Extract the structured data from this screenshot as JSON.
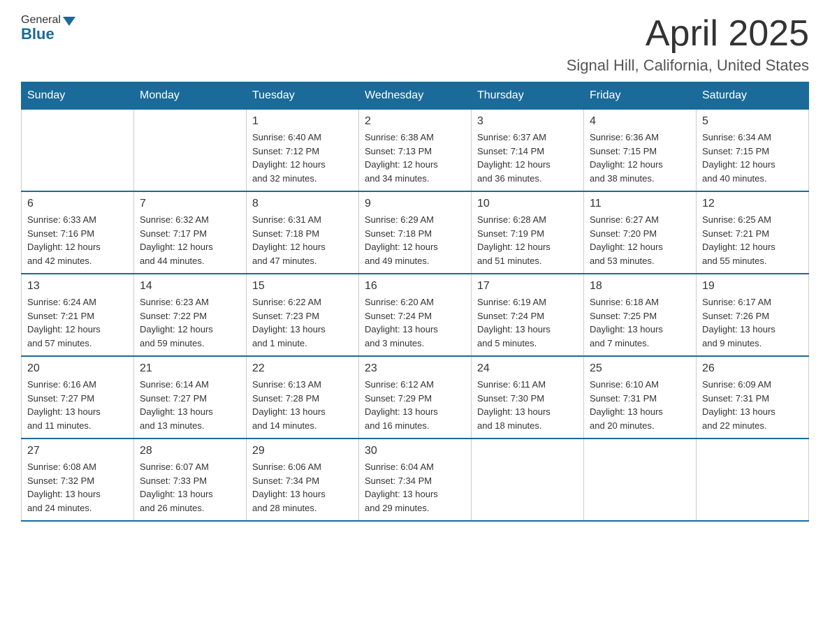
{
  "header": {
    "logo_general": "General",
    "logo_blue": "Blue",
    "title": "April 2025",
    "subtitle": "Signal Hill, California, United States"
  },
  "calendar": {
    "weekdays": [
      "Sunday",
      "Monday",
      "Tuesday",
      "Wednesday",
      "Thursday",
      "Friday",
      "Saturday"
    ],
    "weeks": [
      [
        {
          "day": "",
          "info": ""
        },
        {
          "day": "",
          "info": ""
        },
        {
          "day": "1",
          "info": "Sunrise: 6:40 AM\nSunset: 7:12 PM\nDaylight: 12 hours\nand 32 minutes."
        },
        {
          "day": "2",
          "info": "Sunrise: 6:38 AM\nSunset: 7:13 PM\nDaylight: 12 hours\nand 34 minutes."
        },
        {
          "day": "3",
          "info": "Sunrise: 6:37 AM\nSunset: 7:14 PM\nDaylight: 12 hours\nand 36 minutes."
        },
        {
          "day": "4",
          "info": "Sunrise: 6:36 AM\nSunset: 7:15 PM\nDaylight: 12 hours\nand 38 minutes."
        },
        {
          "day": "5",
          "info": "Sunrise: 6:34 AM\nSunset: 7:15 PM\nDaylight: 12 hours\nand 40 minutes."
        }
      ],
      [
        {
          "day": "6",
          "info": "Sunrise: 6:33 AM\nSunset: 7:16 PM\nDaylight: 12 hours\nand 42 minutes."
        },
        {
          "day": "7",
          "info": "Sunrise: 6:32 AM\nSunset: 7:17 PM\nDaylight: 12 hours\nand 44 minutes."
        },
        {
          "day": "8",
          "info": "Sunrise: 6:31 AM\nSunset: 7:18 PM\nDaylight: 12 hours\nand 47 minutes."
        },
        {
          "day": "9",
          "info": "Sunrise: 6:29 AM\nSunset: 7:18 PM\nDaylight: 12 hours\nand 49 minutes."
        },
        {
          "day": "10",
          "info": "Sunrise: 6:28 AM\nSunset: 7:19 PM\nDaylight: 12 hours\nand 51 minutes."
        },
        {
          "day": "11",
          "info": "Sunrise: 6:27 AM\nSunset: 7:20 PM\nDaylight: 12 hours\nand 53 minutes."
        },
        {
          "day": "12",
          "info": "Sunrise: 6:25 AM\nSunset: 7:21 PM\nDaylight: 12 hours\nand 55 minutes."
        }
      ],
      [
        {
          "day": "13",
          "info": "Sunrise: 6:24 AM\nSunset: 7:21 PM\nDaylight: 12 hours\nand 57 minutes."
        },
        {
          "day": "14",
          "info": "Sunrise: 6:23 AM\nSunset: 7:22 PM\nDaylight: 12 hours\nand 59 minutes."
        },
        {
          "day": "15",
          "info": "Sunrise: 6:22 AM\nSunset: 7:23 PM\nDaylight: 13 hours\nand 1 minute."
        },
        {
          "day": "16",
          "info": "Sunrise: 6:20 AM\nSunset: 7:24 PM\nDaylight: 13 hours\nand 3 minutes."
        },
        {
          "day": "17",
          "info": "Sunrise: 6:19 AM\nSunset: 7:24 PM\nDaylight: 13 hours\nand 5 minutes."
        },
        {
          "day": "18",
          "info": "Sunrise: 6:18 AM\nSunset: 7:25 PM\nDaylight: 13 hours\nand 7 minutes."
        },
        {
          "day": "19",
          "info": "Sunrise: 6:17 AM\nSunset: 7:26 PM\nDaylight: 13 hours\nand 9 minutes."
        }
      ],
      [
        {
          "day": "20",
          "info": "Sunrise: 6:16 AM\nSunset: 7:27 PM\nDaylight: 13 hours\nand 11 minutes."
        },
        {
          "day": "21",
          "info": "Sunrise: 6:14 AM\nSunset: 7:27 PM\nDaylight: 13 hours\nand 13 minutes."
        },
        {
          "day": "22",
          "info": "Sunrise: 6:13 AM\nSunset: 7:28 PM\nDaylight: 13 hours\nand 14 minutes."
        },
        {
          "day": "23",
          "info": "Sunrise: 6:12 AM\nSunset: 7:29 PM\nDaylight: 13 hours\nand 16 minutes."
        },
        {
          "day": "24",
          "info": "Sunrise: 6:11 AM\nSunset: 7:30 PM\nDaylight: 13 hours\nand 18 minutes."
        },
        {
          "day": "25",
          "info": "Sunrise: 6:10 AM\nSunset: 7:31 PM\nDaylight: 13 hours\nand 20 minutes."
        },
        {
          "day": "26",
          "info": "Sunrise: 6:09 AM\nSunset: 7:31 PM\nDaylight: 13 hours\nand 22 minutes."
        }
      ],
      [
        {
          "day": "27",
          "info": "Sunrise: 6:08 AM\nSunset: 7:32 PM\nDaylight: 13 hours\nand 24 minutes."
        },
        {
          "day": "28",
          "info": "Sunrise: 6:07 AM\nSunset: 7:33 PM\nDaylight: 13 hours\nand 26 minutes."
        },
        {
          "day": "29",
          "info": "Sunrise: 6:06 AM\nSunset: 7:34 PM\nDaylight: 13 hours\nand 28 minutes."
        },
        {
          "day": "30",
          "info": "Sunrise: 6:04 AM\nSunset: 7:34 PM\nDaylight: 13 hours\nand 29 minutes."
        },
        {
          "day": "",
          "info": ""
        },
        {
          "day": "",
          "info": ""
        },
        {
          "day": "",
          "info": ""
        }
      ]
    ]
  }
}
